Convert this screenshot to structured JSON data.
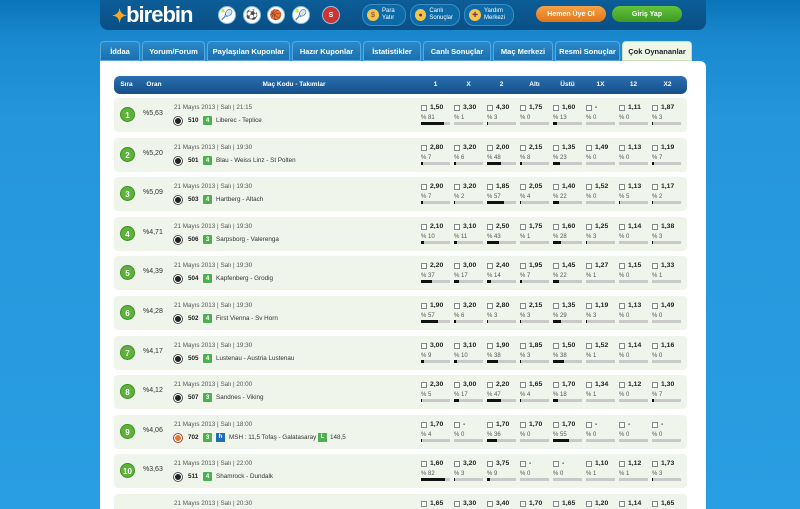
{
  "header": {
    "logo": "birebin",
    "sports": [
      {
        "icon": "tennis-icon",
        "g": "🎾"
      },
      {
        "icon": "football-icon",
        "g": "⚽"
      },
      {
        "icon": "basketball-icon",
        "g": "🏀"
      },
      {
        "icon": "combo-icon",
        "g": "🎾"
      },
      {
        "icon": "spor-toto-icon",
        "g": "S"
      }
    ],
    "para_yatir": [
      "Para",
      "Yatır"
    ],
    "canli": [
      "Canlı",
      "Sonuçlar"
    ],
    "yardim": [
      "Yardım",
      "Merkezi"
    ],
    "register": "Hemen Üye Ol",
    "login": "Giriş Yap",
    "colors": {
      "register": "#f08a24",
      "login": "#4caf2e",
      "accent": "#5db33a"
    }
  },
  "tabs": [
    "İddaa",
    "Yorum/Forum",
    "Paylaşılan Kuponlar",
    "Hazır Kuponlar",
    "İstatistikler",
    "Canlı Sonuçlar",
    "Maç Merkezi",
    "Resmi Sonuçlar",
    "Çok Oynananlar"
  ],
  "active_tab": "Çok Oynananlar",
  "table": {
    "columns": [
      "Sıra",
      "Oran",
      "Maç Kodu - Takımlar",
      "1",
      "X",
      "2",
      "Altı",
      "Üstü",
      "1X",
      "12",
      "X2"
    ],
    "rows": [
      {
        "rank": "1",
        "pct": "%5,63",
        "date": "21 Mayıs 2013 | Salı | 21:15",
        "code": "510",
        "mbs": "4",
        "teams": "Liberec - Teplice",
        "sport": "football",
        "odds": [
          {
            "v": "1,50",
            "p": "% 81",
            "f": 0.81
          },
          {
            "v": "3,30",
            "p": "% 1",
            "f": 0.01
          },
          {
            "v": "4,30",
            "p": "% 3",
            "f": 0.03
          },
          {
            "v": "1,75",
            "p": "% 0",
            "f": 0
          },
          {
            "v": "1,60",
            "p": "% 13",
            "f": 0.13
          },
          {
            "v": "-",
            "p": "% 0",
            "f": 0
          },
          {
            "v": "1,11",
            "p": "% 0",
            "f": 0
          },
          {
            "v": "1,87",
            "p": "% 3",
            "f": 0.03
          }
        ]
      },
      {
        "rank": "2",
        "pct": "%5,20",
        "date": "21 Mayıs 2013 | Salı | 19:30",
        "code": "501",
        "mbs": "4",
        "teams": "Blau - Weiss Linz - St Polten",
        "sport": "football",
        "odds": [
          {
            "v": "2,80",
            "p": "% 7",
            "f": 0.07
          },
          {
            "v": "3,20",
            "p": "% 6",
            "f": 0.06
          },
          {
            "v": "2,00",
            "p": "% 48",
            "f": 0.48
          },
          {
            "v": "2,15",
            "p": "% 8",
            "f": 0.08
          },
          {
            "v": "1,35",
            "p": "% 23",
            "f": 0.23
          },
          {
            "v": "1,49",
            "p": "% 0",
            "f": 0
          },
          {
            "v": "1,13",
            "p": "% 0",
            "f": 0
          },
          {
            "v": "1,19",
            "p": "% 7",
            "f": 0.07
          }
        ]
      },
      {
        "rank": "3",
        "pct": "%5,09",
        "date": "21 Mayıs 2013 | Salı | 19:30",
        "code": "503",
        "mbs": "4",
        "teams": "Hartberg - Altach",
        "sport": "football",
        "odds": [
          {
            "v": "2,90",
            "p": "% 7",
            "f": 0.07
          },
          {
            "v": "3,20",
            "p": "% 2",
            "f": 0.02
          },
          {
            "v": "1,85",
            "p": "% 57",
            "f": 0.57
          },
          {
            "v": "2,05",
            "p": "% 4",
            "f": 0.04
          },
          {
            "v": "1,40",
            "p": "% 22",
            "f": 0.22
          },
          {
            "v": "1,52",
            "p": "% 0",
            "f": 0
          },
          {
            "v": "1,13",
            "p": "% 5",
            "f": 0.05
          },
          {
            "v": "1,17",
            "p": "% 2",
            "f": 0.02
          }
        ]
      },
      {
        "rank": "4",
        "pct": "%4,71",
        "date": "21 Mayıs 2013 | Salı | 19:30",
        "code": "506",
        "mbs": "3",
        "teams": "Sarpsborg - Valerenga",
        "sport": "football",
        "odds": [
          {
            "v": "2,10",
            "p": "% 10",
            "f": 0.1
          },
          {
            "v": "3,10",
            "p": "% 11",
            "f": 0.11
          },
          {
            "v": "2,50",
            "p": "% 43",
            "f": 0.43
          },
          {
            "v": "1,75",
            "p": "% 1",
            "f": 0.01
          },
          {
            "v": "1,60",
            "p": "% 28",
            "f": 0.28
          },
          {
            "v": "1,25",
            "p": "% 3",
            "f": 0.03
          },
          {
            "v": "1,14",
            "p": "% 0",
            "f": 0
          },
          {
            "v": "1,38",
            "p": "% 3",
            "f": 0.03
          }
        ]
      },
      {
        "rank": "5",
        "pct": "%4,39",
        "date": "21 Mayıs 2013 | Salı | 19:30",
        "code": "504",
        "mbs": "4",
        "teams": "Kapfenberg - Grodig",
        "sport": "football",
        "odds": [
          {
            "v": "2,20",
            "p": "% 37",
            "f": 0.37
          },
          {
            "v": "3,00",
            "p": "% 17",
            "f": 0.17
          },
          {
            "v": "2,40",
            "p": "% 14",
            "f": 0.14
          },
          {
            "v": "1,95",
            "p": "% 7",
            "f": 0.07
          },
          {
            "v": "1,45",
            "p": "% 22",
            "f": 0.22
          },
          {
            "v": "1,27",
            "p": "% 1",
            "f": 0.01
          },
          {
            "v": "1,15",
            "p": "% 0",
            "f": 0
          },
          {
            "v": "1,33",
            "p": "% 1",
            "f": 0.01
          }
        ]
      },
      {
        "rank": "6",
        "pct": "%4,28",
        "date": "21 Mayıs 2013 | Salı | 19:30",
        "code": "502",
        "mbs": "4",
        "teams": "First Vienna - Sv Horn",
        "sport": "football",
        "odds": [
          {
            "v": "1,90",
            "p": "% 57",
            "f": 0.57
          },
          {
            "v": "3,20",
            "p": "% 6",
            "f": 0.06
          },
          {
            "v": "2,80",
            "p": "% 3",
            "f": 0.03
          },
          {
            "v": "2,15",
            "p": "% 3",
            "f": 0.03
          },
          {
            "v": "1,35",
            "p": "% 29",
            "f": 0.29
          },
          {
            "v": "1,19",
            "p": "% 3",
            "f": 0.03
          },
          {
            "v": "1,13",
            "p": "% 0",
            "f": 0
          },
          {
            "v": "1,49",
            "p": "% 0",
            "f": 0
          }
        ]
      },
      {
        "rank": "7",
        "pct": "%4,17",
        "date": "21 Mayıs 2013 | Salı | 19:30",
        "code": "505",
        "mbs": "4",
        "teams": "Lustenau - Austria Lustenau",
        "sport": "football",
        "odds": [
          {
            "v": "3,00",
            "p": "% 9",
            "f": 0.09
          },
          {
            "v": "3,10",
            "p": "% 10",
            "f": 0.1
          },
          {
            "v": "1,90",
            "p": "% 38",
            "f": 0.38
          },
          {
            "v": "1,85",
            "p": "% 3",
            "f": 0.03
          },
          {
            "v": "1,50",
            "p": "% 38",
            "f": 0.38
          },
          {
            "v": "1,52",
            "p": "% 1",
            "f": 0.01
          },
          {
            "v": "1,14",
            "p": "% 0",
            "f": 0
          },
          {
            "v": "1,16",
            "p": "% 0",
            "f": 0
          }
        ]
      },
      {
        "rank": "8",
        "pct": "%4,12",
        "date": "21 Mayıs 2013 | Salı | 20:00",
        "code": "507",
        "mbs": "3",
        "teams": "Sandnes - Viking",
        "sport": "football",
        "odds": [
          {
            "v": "2,30",
            "p": "% 5",
            "f": 0.05
          },
          {
            "v": "3,00",
            "p": "% 17",
            "f": 0.17
          },
          {
            "v": "2,20",
            "p": "% 47",
            "f": 0.47
          },
          {
            "v": "1,65",
            "p": "% 4",
            "f": 0.04
          },
          {
            "v": "1,70",
            "p": "% 18",
            "f": 0.18
          },
          {
            "v": "1,34",
            "p": "% 1",
            "f": 0.01
          },
          {
            "v": "1,12",
            "p": "% 0",
            "f": 0
          },
          {
            "v": "1,30",
            "p": "% 7",
            "f": 0.07
          }
        ]
      },
      {
        "rank": "9",
        "pct": "%4,06",
        "date": "21 Mayıs 2013 | Salı | 18:00",
        "code": "702",
        "mbs": "3",
        "teams": "MSH : 11,5 Tofaş - Galatasaray",
        "line": "148,5",
        "sport": "basketball",
        "odds": [
          {
            "v": "1,70",
            "p": "% 4",
            "f": 0.04
          },
          {
            "v": "-",
            "p": "% 0",
            "f": 0
          },
          {
            "v": "1,70",
            "p": "% 36",
            "f": 0.36
          },
          {
            "v": "1,70",
            "p": "% 0",
            "f": 0
          },
          {
            "v": "1,70",
            "p": "% 55",
            "f": 0.55
          },
          {
            "v": "-",
            "p": "% 0",
            "f": 0
          },
          {
            "v": "-",
            "p": "% 0",
            "f": 0
          },
          {
            "v": "-",
            "p": "% 0",
            "f": 0
          }
        ]
      },
      {
        "rank": "10",
        "pct": "%3,63",
        "date": "21 Mayıs 2013 | Salı | 22:00",
        "code": "511",
        "mbs": "4",
        "teams": "Shamrock - Dundalk",
        "sport": "football",
        "odds": [
          {
            "v": "1,60",
            "p": "% 82",
            "f": 0.82
          },
          {
            "v": "3,20",
            "p": "% 3",
            "f": 0.03
          },
          {
            "v": "3,75",
            "p": "% 9",
            "f": 0.09
          },
          {
            "v": "-",
            "p": "% 0",
            "f": 0
          },
          {
            "v": "-",
            "p": "% 0",
            "f": 0
          },
          {
            "v": "1,10",
            "p": "% 1",
            "f": 0.01
          },
          {
            "v": "1,12",
            "p": "% 1",
            "f": 0.01
          },
          {
            "v": "1,73",
            "p": "% 3",
            "f": 0.03
          }
        ]
      },
      {
        "rank": "",
        "pct": "",
        "date": "21 Mayıs 2013 | Salı | 20:30",
        "code": "",
        "mbs": "",
        "teams": "",
        "sport": "",
        "odds": [
          {
            "v": "1,65",
            "p": "",
            "f": 0
          },
          {
            "v": "3,30",
            "p": "",
            "f": 0
          },
          {
            "v": "3,40",
            "p": "",
            "f": 0
          },
          {
            "v": "1,70",
            "p": "",
            "f": 0
          },
          {
            "v": "1,65",
            "p": "",
            "f": 0
          },
          {
            "v": "1,20",
            "p": "",
            "f": 0
          },
          {
            "v": "1,14",
            "p": "",
            "f": 0
          },
          {
            "v": "1,65",
            "p": "",
            "f": 0
          }
        ]
      }
    ]
  }
}
